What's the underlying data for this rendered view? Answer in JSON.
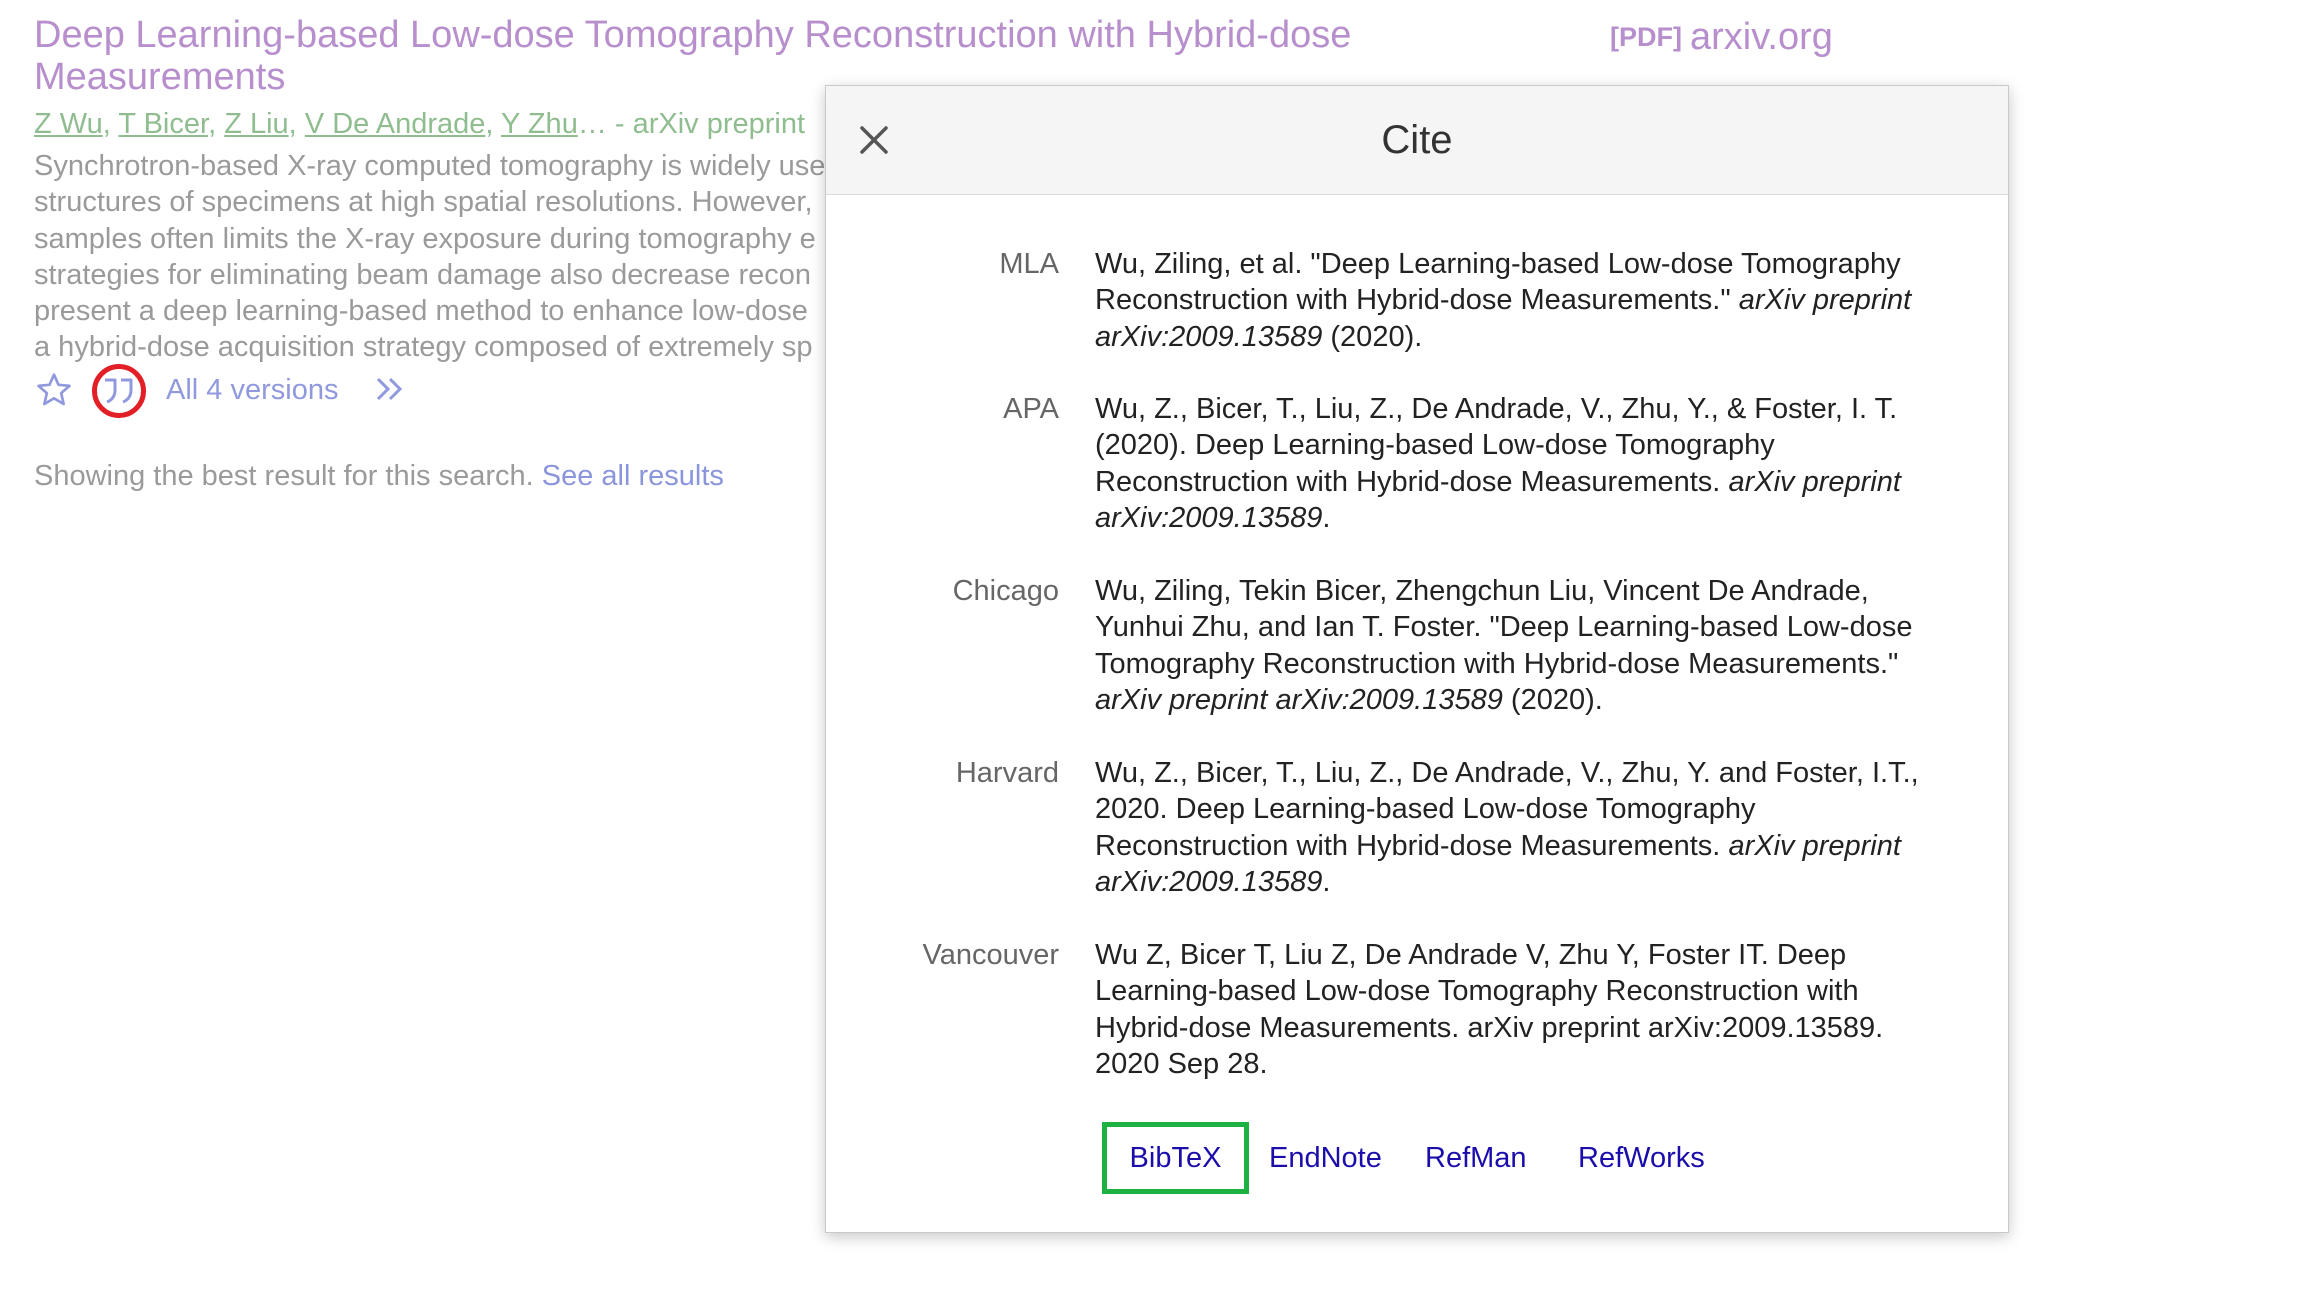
{
  "result": {
    "title": "Deep Learning-based Low-dose Tomography Reconstruction with Hybrid-dose Measurements",
    "pdf_tag": "[PDF]",
    "pdf_source": "arxiv.org",
    "authors": [
      "Z Wu",
      "T Bicer",
      "Z Liu",
      "V De Andrade",
      "Y Zhu"
    ],
    "authors_suffix": "… - arXiv preprint",
    "snippet_lines": [
      "Synchrotron-based X-ray computed tomography is widely used",
      "structures of specimens at high spatial resolutions. However,",
      "samples often limits the X-ray exposure during tomography e",
      "strategies for eliminating beam damage also decrease recon",
      "present a deep learning-based method to enhance low-dose",
      "a hybrid-dose acquisition strategy composed of extremely sp"
    ],
    "versions_label": "All 4 versions",
    "showing_text": "Showing the best result for this search.",
    "see_all_label": "See all results"
  },
  "modal": {
    "title": "Cite",
    "citations": [
      {
        "style": "MLA",
        "parts": [
          {
            "t": "Wu, Ziling, et al. \"Deep Learning-based Low-dose Tomography Reconstruction with Hybrid-dose Measurements.\" "
          },
          {
            "t": "arXiv preprint arXiv:2009.13589",
            "i": true
          },
          {
            "t": " (2020)."
          }
        ]
      },
      {
        "style": "APA",
        "parts": [
          {
            "t": "Wu, Z., Bicer, T., Liu, Z., De Andrade, V., Zhu, Y., & Foster, I. T. (2020). Deep Learning-based Low-dose Tomography Reconstruction with Hybrid-dose Measurements. "
          },
          {
            "t": "arXiv preprint arXiv:2009.13589",
            "i": true
          },
          {
            "t": "."
          }
        ]
      },
      {
        "style": "Chicago",
        "parts": [
          {
            "t": "Wu, Ziling, Tekin Bicer, Zhengchun Liu, Vincent De Andrade, Yunhui Zhu, and Ian T. Foster. \"Deep Learning-based Low-dose Tomography Reconstruction with Hybrid-dose Measurements.\" "
          },
          {
            "t": "arXiv preprint arXiv:2009.13589",
            "i": true
          },
          {
            "t": " (2020)."
          }
        ]
      },
      {
        "style": "Harvard",
        "parts": [
          {
            "t": "Wu, Z., Bicer, T., Liu, Z., De Andrade, V., Zhu, Y. and Foster, I.T., 2020. Deep Learning-based Low-dose Tomography Reconstruction with Hybrid-dose Measurements. "
          },
          {
            "t": "arXiv preprint arXiv:2009.13589",
            "i": true
          },
          {
            "t": "."
          }
        ]
      },
      {
        "style": "Vancouver",
        "parts": [
          {
            "t": "Wu Z, Bicer T, Liu Z, De Andrade V, Zhu Y, Foster IT. Deep Learning-based Low-dose Tomography Reconstruction with Hybrid-dose Measurements. arXiv preprint arXiv:2009.13589. 2020 Sep 28."
          }
        ]
      }
    ],
    "export_links": {
      "bibtex": "BibTeX",
      "endnote": "EndNote",
      "refman": "RefMan",
      "refworks": "RefWorks"
    }
  },
  "icons": {
    "star": "star-icon",
    "cite": "quote-icon",
    "related": "double-chevron-icon",
    "close": "close-icon"
  },
  "colors": {
    "visited_link": "#b88fcd",
    "author_link": "#8fbd8f",
    "highlight_red": "#e21f26",
    "highlight_green": "#1db142",
    "export_link": "#1a0dab"
  }
}
